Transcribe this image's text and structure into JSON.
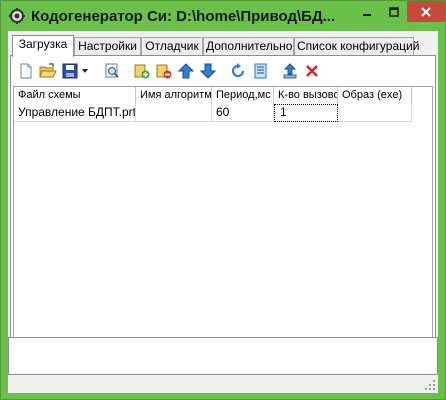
{
  "window": {
    "title": "Кодогенератор Си: D:\\home\\Привод\\БД...",
    "accent_color": "#6bc04a",
    "close_color": "#c7493a"
  },
  "tabs": [
    {
      "label": "Загрузка",
      "active": true
    },
    {
      "label": "Настройки",
      "active": false
    },
    {
      "label": "Отладчик",
      "active": false
    },
    {
      "label": "Дополнительно",
      "active": false
    },
    {
      "label": "Список конфигураций",
      "active": false
    }
  ],
  "toolbar": {
    "buttons": [
      {
        "icon": "new-document-icon"
      },
      {
        "icon": "open-folder-icon"
      },
      {
        "icon": "save-disk-icon"
      },
      {
        "icon": "dropdown-arrow-icon"
      },
      {
        "icon": "preview-icon"
      },
      {
        "icon": "add-item-icon"
      },
      {
        "icon": "remove-item-icon"
      },
      {
        "icon": "move-up-icon"
      },
      {
        "icon": "move-down-icon"
      },
      {
        "icon": "refresh-icon"
      },
      {
        "icon": "list-icon"
      },
      {
        "icon": "upload-icon"
      },
      {
        "icon": "delete-icon"
      }
    ]
  },
  "grid": {
    "columns": [
      "Файл схемы",
      "Имя алгоритма",
      "Период,мс",
      "К-во вызовов",
      "Образ (exe)"
    ],
    "rows": [
      [
        "Управление БДПТ.prt",
        "",
        "60",
        "1",
        ""
      ]
    ]
  },
  "log": {
    "text": ""
  },
  "status": {
    "text": ""
  }
}
